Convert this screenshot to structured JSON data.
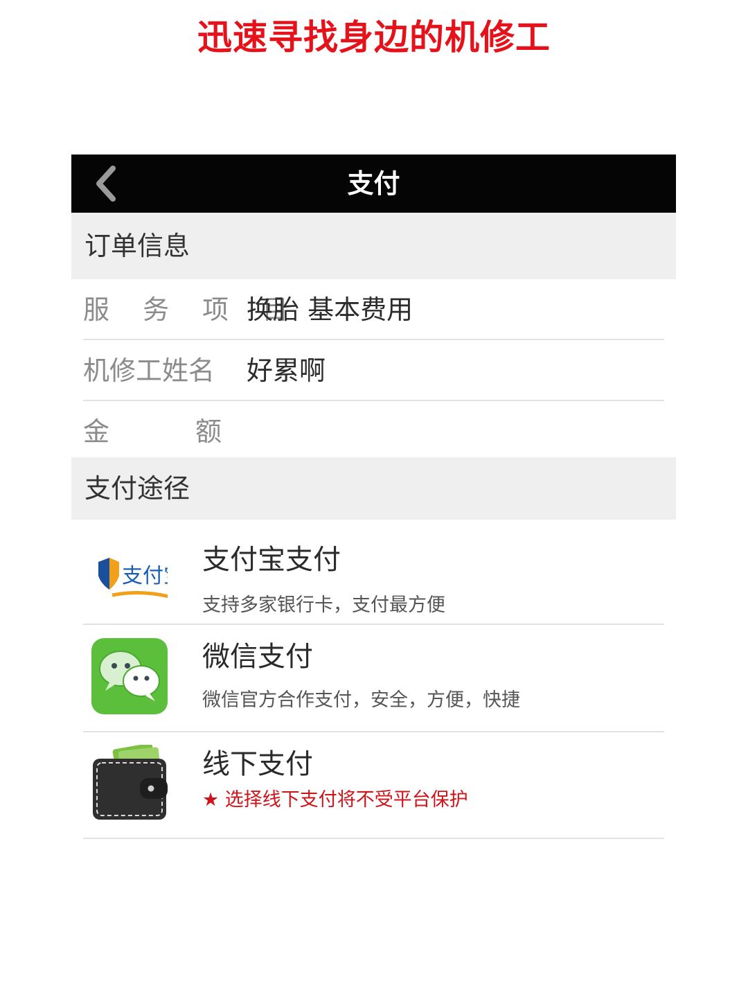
{
  "promo": {
    "title": "迅速寻找身边的机修工"
  },
  "nav": {
    "back_icon": "chevron-left-icon",
    "title": "支付"
  },
  "order_info": {
    "header": "订单信息",
    "service_label": "服 务 项 目",
    "service_value": "换胎 基本费用",
    "mechanic_label": "机修工姓名",
    "mechanic_value": "好累啊",
    "amount_label_left": "金",
    "amount_label_right": "额",
    "amount_value": ""
  },
  "payment": {
    "header": "支付途径",
    "options": [
      {
        "name": "支付宝支付",
        "desc": "支持多家银行卡，支付最方便",
        "icon": "alipay-icon",
        "logo_text": "支付宝"
      },
      {
        "name": "微信支付",
        "desc": "微信官方合作支付，安全，方便，快捷",
        "icon": "wechat-icon"
      },
      {
        "name": "线下支付",
        "desc": "★ 选择线下支付将不受平台保护",
        "icon": "wallet-icon"
      }
    ]
  },
  "colors": {
    "promo_red": "#e5121b",
    "nav_bar": "#050505",
    "section_bg": "#efefef",
    "wechat_green": "#5bbf3c",
    "warning_red": "#cf1419"
  }
}
